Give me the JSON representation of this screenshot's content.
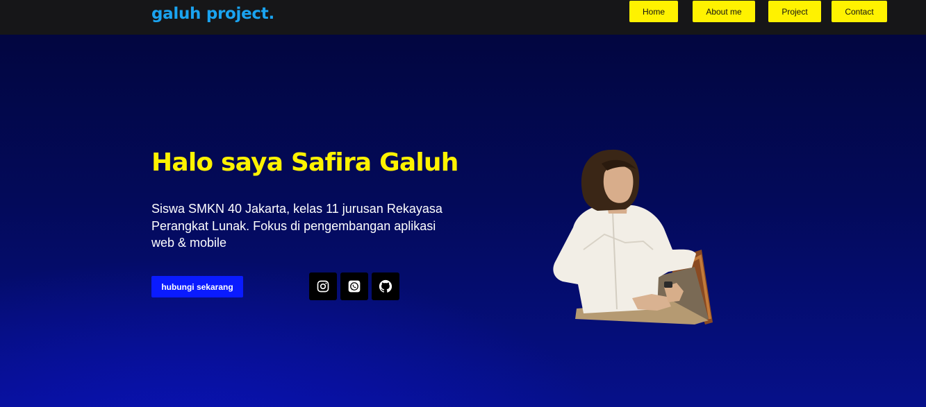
{
  "brand": {
    "name": "galuh project."
  },
  "nav": {
    "items": [
      {
        "label": "Home"
      },
      {
        "label": "About me"
      },
      {
        "label": "Project"
      },
      {
        "label": "Contact"
      }
    ]
  },
  "hero": {
    "title": "Halo saya Safira Galuh",
    "description": "Siswa SMKN 40 Jakarta, kelas 11 jurusan Rekayasa Perangkat Lunak. Fokus di pengembangan aplikasi web & mobile",
    "cta_label": "hubungi sekarang",
    "social_icons": [
      "instagram-icon",
      "whatsapp-icon",
      "github-icon"
    ],
    "photo": "profile-photo"
  },
  "colors": {
    "navbar_bg": "#161618",
    "brand": "#1aa3f0",
    "nav_button_bg": "#fff200",
    "title": "#fff200",
    "cta_bg": "#0a1bff",
    "hero_bg_top": "#020640",
    "hero_bg_bottom": "#06108a"
  }
}
